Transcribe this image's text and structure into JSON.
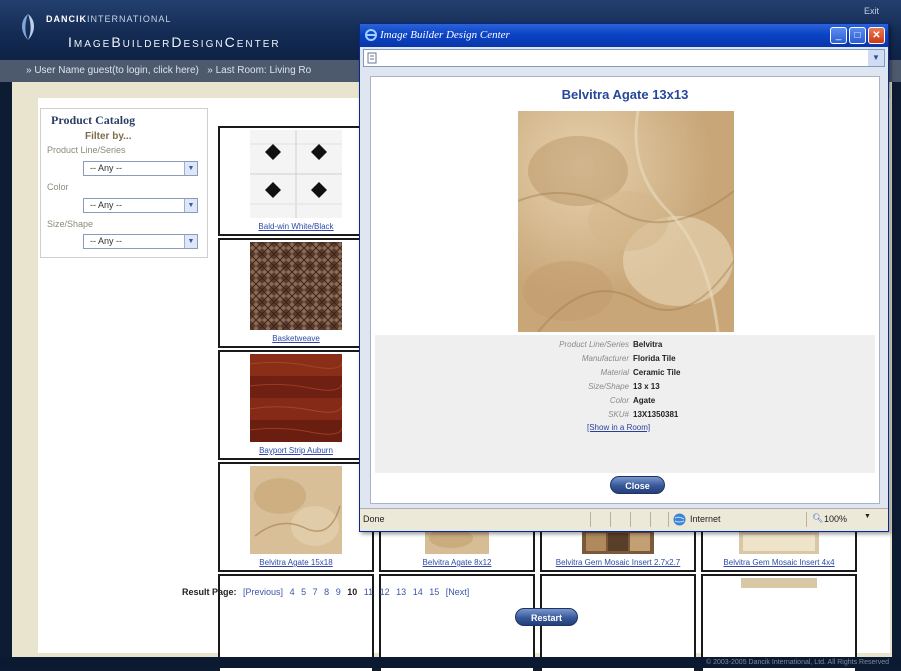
{
  "header": {
    "brand_prefix": "DANCIK",
    "brand_suffix": "INTERNATIONAL",
    "brand_main": "ImageBuilderDesignCenter",
    "exit_label": "Exit"
  },
  "info_bar": {
    "user_prefix": "» User Name guest(to login,",
    "login_link": "click here",
    "user_suffix": ")",
    "room_prefix": "» Last Room:",
    "room_link": "Living Ro"
  },
  "catalog": {
    "title": "Product Catalog",
    "filter_title": "Filter by...",
    "filters": [
      {
        "label": "Product Line/Series",
        "value": "-- Any --"
      },
      {
        "label": "Color",
        "value": "-- Any --"
      },
      {
        "label": "Size/Shape",
        "value": "-- Any --"
      }
    ]
  },
  "grid": {
    "tiles": [
      {
        "caption": "Bald-win White/Black"
      },
      {
        "caption": "Basketweave"
      },
      {
        "caption": "Bayport Strip Auburn"
      },
      {
        "caption": "Belvitra Agate 15x18"
      },
      {
        "caption": "Belvitra Agate 8x12"
      },
      {
        "caption": "Belvitra Gem Mosaic Insert 2.7x2.7"
      },
      {
        "caption": "Belvitra Gem Mosaic Insert 4x4"
      }
    ]
  },
  "pager": {
    "label": "Result Page:",
    "previous": "[Previous]",
    "pages_before": [
      "4",
      "5",
      "7",
      "8",
      "9"
    ],
    "current": "10",
    "pages_after": [
      "11",
      "12",
      "13",
      "14",
      "15"
    ],
    "next": "[Next]"
  },
  "restart_label": "Restart",
  "footer_text": "© 2003-2005 Dancik International, Ltd. All Rights Reserved",
  "popup": {
    "window_title": "Image Builder Design Center",
    "product_title": "Belvitra Agate 13x13",
    "details": [
      {
        "label": "Product Line/Series",
        "value": "Belvitra"
      },
      {
        "label": "Manufacturer",
        "value": "Florida Tile"
      },
      {
        "label": "Material",
        "value": "Ceramic Tile"
      },
      {
        "label": "Size/Shape",
        "value": "13 x 13"
      },
      {
        "label": "Color",
        "value": "Agate"
      },
      {
        "label": "SKU#",
        "value": "13X1350381"
      }
    ],
    "show_in_room": "[Show in a Room]",
    "close_label": "Close",
    "status_text": "Done",
    "zone_text": "Internet",
    "zoom_text": "100%"
  }
}
